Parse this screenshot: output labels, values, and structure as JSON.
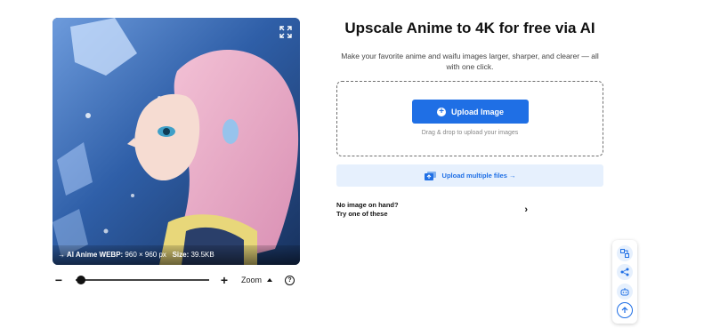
{
  "hero": {
    "title": "Upscale Anime to 4K for free via AI",
    "subtitle": "Make your favorite anime and waifu images larger, sharper, and clearer — all with one click."
  },
  "upload": {
    "button_label": "Upload Image",
    "drag_hint": "Drag & drop to upload your images",
    "multiple_label": "Upload multiple files →"
  },
  "samples": {
    "line1": "No image on hand?",
    "line2": "Try one of these"
  },
  "viewer": {
    "info_prefix": "→ AI Anime WEBP:",
    "dimensions": "960 × 960 px",
    "size_label": "Size:",
    "size_value": "39.5KB"
  },
  "zoom": {
    "label": "Zoom",
    "level": 0.04
  },
  "colors": {
    "accent": "#1f6fe5",
    "accent_light": "#e6f0fd"
  },
  "icons": {
    "expand": "expand-icon",
    "upload_plus": "plus-circle-icon",
    "multiple": "multi-upload-icon",
    "chevron": "chevron-right-icon",
    "help": "help-icon",
    "side": [
      "transform-icon",
      "share-icon",
      "robot-icon",
      "arrow-up-icon"
    ]
  }
}
